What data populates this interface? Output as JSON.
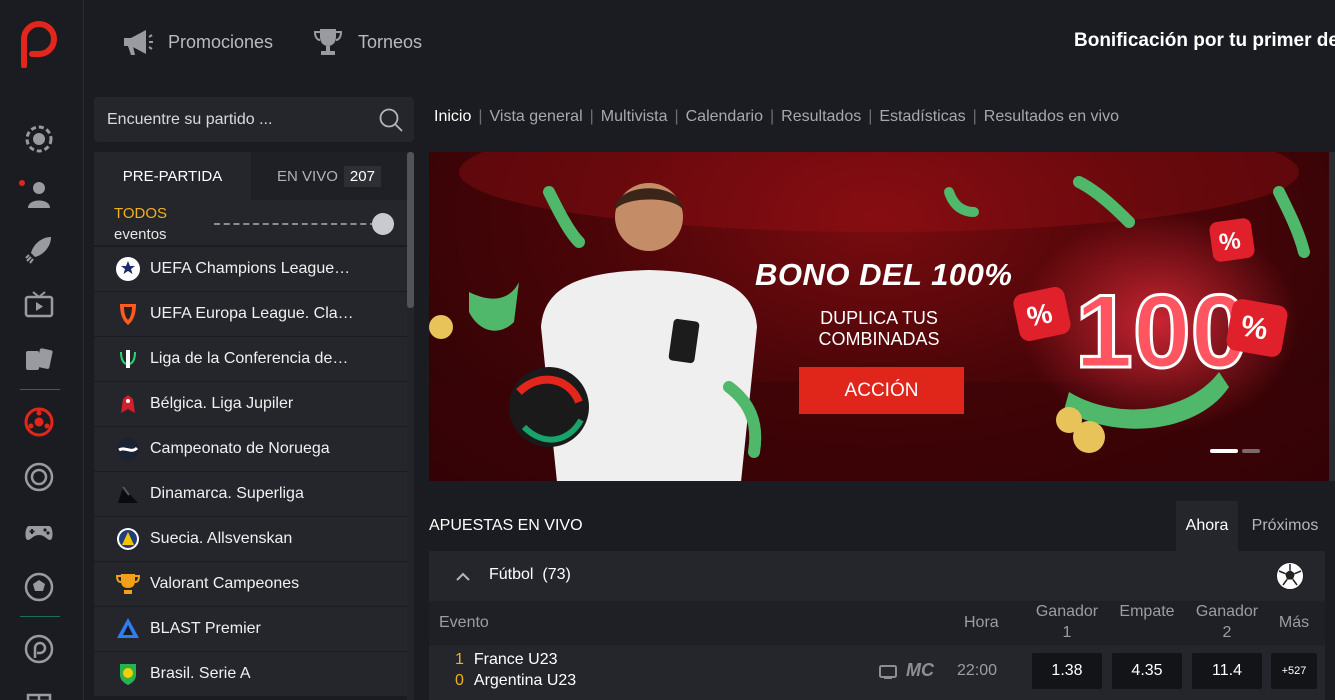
{
  "topbar": {
    "promotions_label": "Promociones",
    "tournaments_label": "Torneos",
    "promo_text": "Bonificación por tu primer dep"
  },
  "sidebar": {
    "search_placeholder": "Encuentre su partido ...",
    "tab_prematch": "PRE-PARTIDA",
    "tab_live": "EN VIVO",
    "live_count": "207",
    "filter_all": "TODOS",
    "filter_events": "eventos",
    "leagues": [
      {
        "name": "UEFA Champions League…",
        "icon": "champions-league-icon"
      },
      {
        "name": "UEFA Europa League. Cla…",
        "icon": "europa-league-icon"
      },
      {
        "name": "Liga de la Conferencia de…",
        "icon": "conference-league-icon"
      },
      {
        "name": "Bélgica. Liga Jupiler",
        "icon": "jupiler-league-icon"
      },
      {
        "name": "Campeonato de Noruega",
        "icon": "norway-league-icon"
      },
      {
        "name": "Dinamarca. Superliga",
        "icon": "denmark-superliga-icon"
      },
      {
        "name": "Suecia. Allsvenskan",
        "icon": "allsvenskan-icon"
      },
      {
        "name": "Valorant Campeones",
        "icon": "trophy-icon"
      },
      {
        "name": "BLAST Premier",
        "icon": "blast-icon"
      },
      {
        "name": "Brasil. Serie A",
        "icon": "brasileirao-icon"
      }
    ]
  },
  "nav": {
    "items": [
      "Inicio",
      "Vista general",
      "Multivista",
      "Calendario",
      "Resultados",
      "Estadísticas",
      "Resultados en vivo"
    ]
  },
  "banner": {
    "title": "BONO DEL 100%",
    "subtitle": "DUPLICA TUS COMBINADAS",
    "button": "ACCIÓN"
  },
  "live": {
    "title": "APUESTAS EN VIVO",
    "tab_now": "Ahora",
    "tab_next": "Próximos",
    "sport_name": "Fútbol",
    "sport_count": "(73)",
    "headers": {
      "event": "Evento",
      "time": "Hora",
      "win1": "Ganador 1",
      "draw": "Empate",
      "win2": "Ganador 2",
      "more": "Más"
    },
    "match": {
      "home_score": "1",
      "home_team": "France U23",
      "away_score": "0",
      "away_team": "Argentina U23",
      "mc": "MC",
      "time": "22:00",
      "odd1": "1.38",
      "oddx": "4.35",
      "odd2": "11.4",
      "more": "+527"
    }
  },
  "colors": {
    "accent": "#e2261c",
    "gold": "#f2b01e",
    "background": "#1b1c21",
    "panel": "#25262c"
  }
}
